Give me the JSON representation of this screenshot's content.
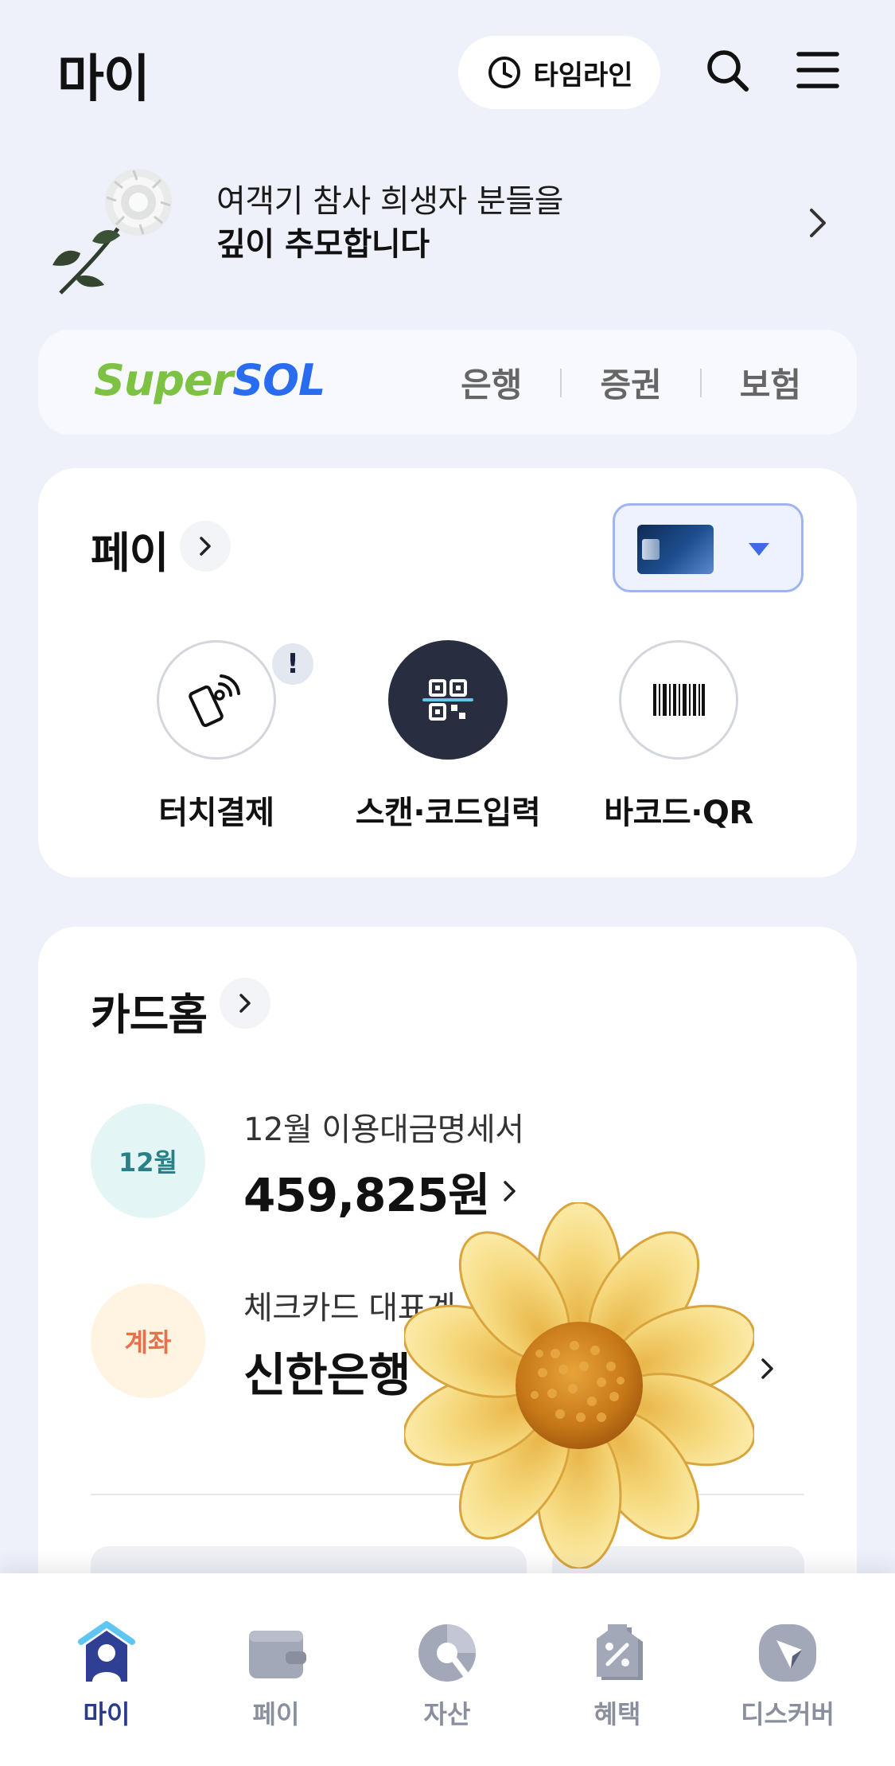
{
  "header": {
    "title": "마이",
    "timeline_label": "타임라인"
  },
  "memorial": {
    "line1": "여객기 참사 희생자 분들을",
    "line2": "깊이 추모합니다"
  },
  "supersol": {
    "logo_super": "Super",
    "logo_sol": "SOL",
    "tabs": [
      "은행",
      "증권",
      "보험"
    ]
  },
  "pay": {
    "title": "페이",
    "actions": [
      {
        "label": "터치결제",
        "icon": "phone-nfc-icon",
        "alert": "!"
      },
      {
        "label": "스캔·코드입력",
        "icon": "qr-scan-icon"
      },
      {
        "label": "바코드·QR",
        "icon": "barcode-icon"
      }
    ]
  },
  "card_home": {
    "title": "카드홈",
    "rows": [
      {
        "badge": "12월",
        "label": "12월 이용대금명세서",
        "value": "459,825원"
      },
      {
        "badge": "계좌",
        "label": "체크카드 대표계",
        "value": "신한은행"
      }
    ]
  },
  "bottom_nav": {
    "items": [
      {
        "label": "마이",
        "icon": "home-person-icon",
        "active": true
      },
      {
        "label": "페이",
        "icon": "wallet-icon",
        "active": false
      },
      {
        "label": "자산",
        "icon": "pie-chart-icon",
        "active": false
      },
      {
        "label": "혜택",
        "icon": "coupon-tag-icon",
        "active": false
      },
      {
        "label": "디스커버",
        "icon": "compass-icon",
        "active": false
      }
    ]
  },
  "colors": {
    "background": "#EEF1FA",
    "accent_blue": "#2A6CF0",
    "super_green": "#7DC242",
    "nav_active": "#2A3A8C",
    "badge_month_bg": "#E3F5F5",
    "badge_month_fg": "#2B7F86",
    "badge_account_bg": "#FFF3E2",
    "badge_account_fg": "#E8704A"
  }
}
